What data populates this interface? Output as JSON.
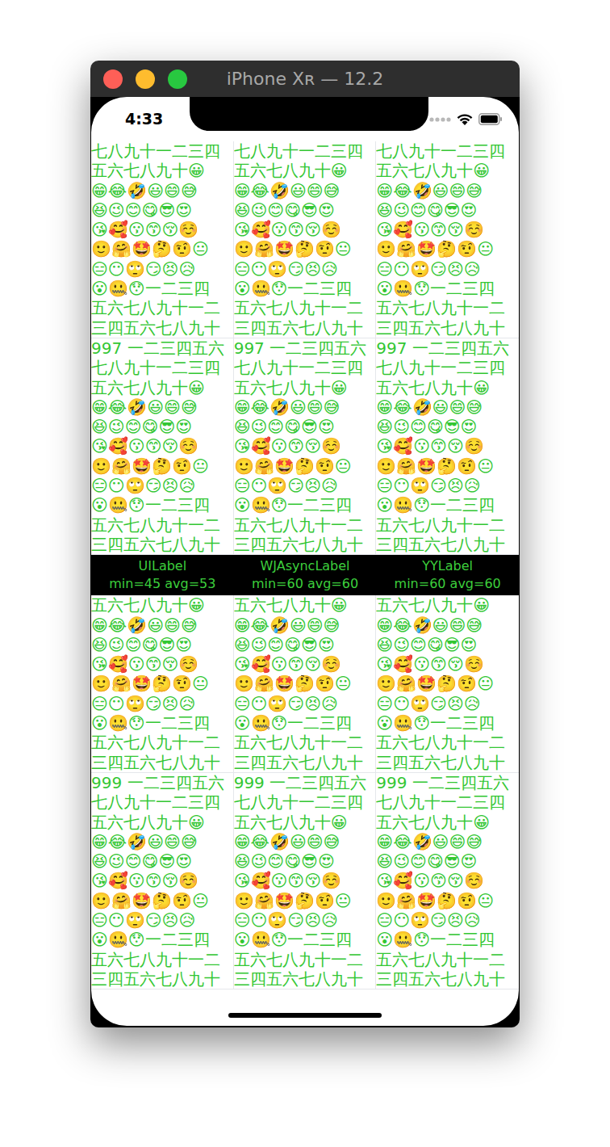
{
  "device": {
    "title": "iPhone Xʀ — 12.2"
  },
  "status_bar": {
    "time": "4:33"
  },
  "rows_above": [
    {
      "lines": [
        "七八九十一二三四",
        "五六七八九十😀",
        "😁😂🤣😃😄😅",
        "😆😉😊😋😎😍",
        "😘🥰😗😙😚☺️",
        "🙂🤗🤩🤔🤨😐",
        "😑😶🙄😏😣😥",
        "😮🤐😯一二三四",
        "五六七八九十一二",
        "三四五六七八九十"
      ]
    },
    {
      "lines": [
        "997 一二三四五六",
        "七八九十一二三四",
        "五六七八九十😀",
        "😁😂🤣😃😄😅",
        "😆😉😊😋😎😍",
        "😘🥰😗😙😚☺️",
        "🙂🤗🤩🤔🤨😐",
        "😑😶🙄😏😣😥",
        "😮🤐😯一二三四",
        "五六七八九十一二",
        "三四五六七八九十"
      ]
    }
  ],
  "bar": [
    {
      "name": "UILabel",
      "stats": "min=45 avg=53"
    },
    {
      "name": "WJAsyncLabel",
      "stats": "min=60 avg=60"
    },
    {
      "name": "YYLabel",
      "stats": "min=60 avg=60"
    }
  ],
  "rows_below": [
    {
      "lines": [
        "五六七八九十😀",
        "😁😂🤣😃😄😅",
        "😆😉😊😋😎😍",
        "😘🥰😗😙😚☺️",
        "🙂🤗🤩🤔🤨😐",
        "😑😶🙄😏😣😥",
        "😮🤐😯一二三四",
        "五六七八九十一二",
        "三四五六七八九十"
      ]
    },
    {
      "lines": [
        "999 一二三四五六",
        "七八九十一二三四",
        "五六七八九十😀",
        "😁😂🤣😃😄😅",
        "😆😉😊😋😎😍",
        "😘🥰😗😙😚☺️",
        "🙂🤗🤩🤔🤨😐",
        "😑😶🙄😏😣😥",
        "😮🤐😯一二三四",
        "五六七八九十一二",
        "三四五六七八九十"
      ]
    }
  ]
}
